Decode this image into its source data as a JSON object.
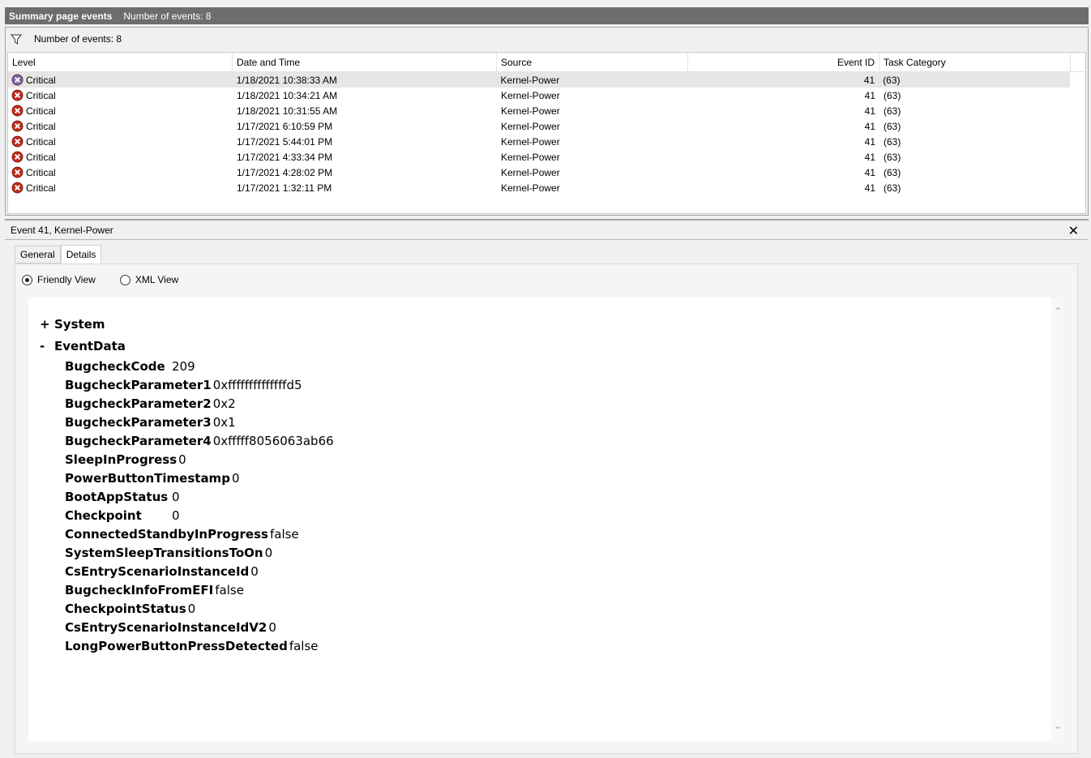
{
  "titlebar": {
    "title": "Summary page events",
    "count": "Number of events: 8"
  },
  "filter": {
    "label": "Number of events: 8"
  },
  "grid": {
    "columns": [
      "Level",
      "Date and Time",
      "Source",
      "Event ID",
      "Task Category"
    ],
    "rows": [
      {
        "level": "Critical",
        "date": "1/18/2021 10:38:33 AM",
        "source": "Kernel-Power",
        "eid": "41",
        "task": "(63)"
      },
      {
        "level": "Critical",
        "date": "1/18/2021 10:34:21 AM",
        "source": "Kernel-Power",
        "eid": "41",
        "task": "(63)"
      },
      {
        "level": "Critical",
        "date": "1/18/2021 10:31:55 AM",
        "source": "Kernel-Power",
        "eid": "41",
        "task": "(63)"
      },
      {
        "level": "Critical",
        "date": "1/17/2021 6:10:59 PM",
        "source": "Kernel-Power",
        "eid": "41",
        "task": "(63)"
      },
      {
        "level": "Critical",
        "date": "1/17/2021 5:44:01 PM",
        "source": "Kernel-Power",
        "eid": "41",
        "task": "(63)"
      },
      {
        "level": "Critical",
        "date": "1/17/2021 4:33:34 PM",
        "source": "Kernel-Power",
        "eid": "41",
        "task": "(63)"
      },
      {
        "level": "Critical",
        "date": "1/17/2021 4:28:02 PM",
        "source": "Kernel-Power",
        "eid": "41",
        "task": "(63)"
      },
      {
        "level": "Critical",
        "date": "1/17/2021 1:32:11 PM",
        "source": "Kernel-Power",
        "eid": "41",
        "task": "(63)"
      }
    ]
  },
  "detail": {
    "header": "Event 41, Kernel-Power",
    "close": "✕",
    "tabs": [
      "General",
      "Details"
    ],
    "radios": [
      "Friendly View",
      "XML View"
    ],
    "tree": {
      "system": {
        "sign": "+",
        "label": "System"
      },
      "eventdata": {
        "sign": "-",
        "label": "EventData"
      },
      "fields": [
        {
          "name": "BugcheckCode",
          "value": "209"
        },
        {
          "name": "BugcheckParameter1",
          "value": "0xffffffffffffffd5"
        },
        {
          "name": "BugcheckParameter2",
          "value": "0x2"
        },
        {
          "name": "BugcheckParameter3",
          "value": "0x1"
        },
        {
          "name": "BugcheckParameter4",
          "value": "0xfffff8056063ab66"
        },
        {
          "name": "SleepInProgress",
          "value": "0"
        },
        {
          "name": "PowerButtonTimestamp",
          "value": "0"
        },
        {
          "name": "BootAppStatus",
          "value": "0"
        },
        {
          "name": "Checkpoint",
          "value": "0"
        },
        {
          "name": "ConnectedStandbyInProgress",
          "value": "false"
        },
        {
          "name": "SystemSleepTransitionsToOn",
          "value": "0"
        },
        {
          "name": "CsEntryScenarioInstanceId",
          "value": "0"
        },
        {
          "name": "BugcheckInfoFromEFI",
          "value": "false"
        },
        {
          "name": "CheckpointStatus",
          "value": "0"
        },
        {
          "name": "CsEntryScenarioInstanceIdV2",
          "value": "0"
        },
        {
          "name": "LongPowerButtonPressDetected",
          "value": "false"
        }
      ]
    }
  },
  "colors": {
    "titlebar": "#6d6d6d",
    "critical": "#c42b1c",
    "selected_row": "#e6e6e6"
  },
  "icons": {
    "filter": "filter-icon",
    "critical": "critical-error-icon",
    "close": "close-icon"
  }
}
